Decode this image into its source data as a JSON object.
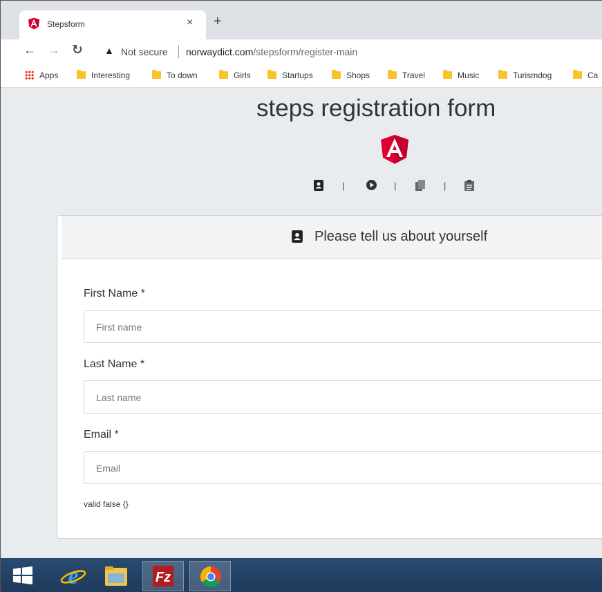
{
  "browser": {
    "tab_title": "Stepsform",
    "tab_close": "×",
    "new_tab": "+",
    "not_secure": "Not secure",
    "url_domain": "norwaydict.com",
    "url_path": "/stepsform/register-main"
  },
  "bookmarks": [
    {
      "label": "Apps",
      "icon": "apps-grid-icon"
    },
    {
      "label": "Interesting",
      "icon": "folder-icon"
    },
    {
      "label": "To down",
      "icon": "folder-icon"
    },
    {
      "label": "Girls",
      "icon": "folder-icon"
    },
    {
      "label": "Startups",
      "icon": "folder-icon"
    },
    {
      "label": "Shops",
      "icon": "folder-icon"
    },
    {
      "label": "Travel",
      "icon": "folder-icon"
    },
    {
      "label": "Music",
      "icon": "folder-icon"
    },
    {
      "label": "Turismdog",
      "icon": "folder-icon"
    },
    {
      "label": "Ca",
      "icon": "folder-icon"
    }
  ],
  "page": {
    "title": "steps registration form",
    "steps": [
      {
        "icon": "contact-card-icon"
      },
      {
        "icon": "play-circle-icon"
      },
      {
        "icon": "copy-icon"
      },
      {
        "icon": "clipboard-icon"
      }
    ],
    "step_separator": "|",
    "card": {
      "header": "Please tell us about yourself",
      "fields": [
        {
          "label": "First Name *",
          "placeholder": "First name"
        },
        {
          "label": "Last Name *",
          "placeholder": "Last name"
        },
        {
          "label": "Email *",
          "placeholder": "Email"
        }
      ],
      "status": "valid false {}"
    }
  },
  "taskbar": {
    "items": [
      {
        "icon": "windows-start-icon"
      },
      {
        "icon": "internet-explorer-icon"
      },
      {
        "icon": "file-explorer-icon"
      },
      {
        "icon": "filezilla-icon"
      },
      {
        "icon": "chrome-icon"
      }
    ]
  },
  "colors": {
    "angular_red": "#dd0031",
    "page_bg": "#e9ecef",
    "taskbar": "#1e3a5c",
    "bookmark_folder": "#f7c52b"
  }
}
